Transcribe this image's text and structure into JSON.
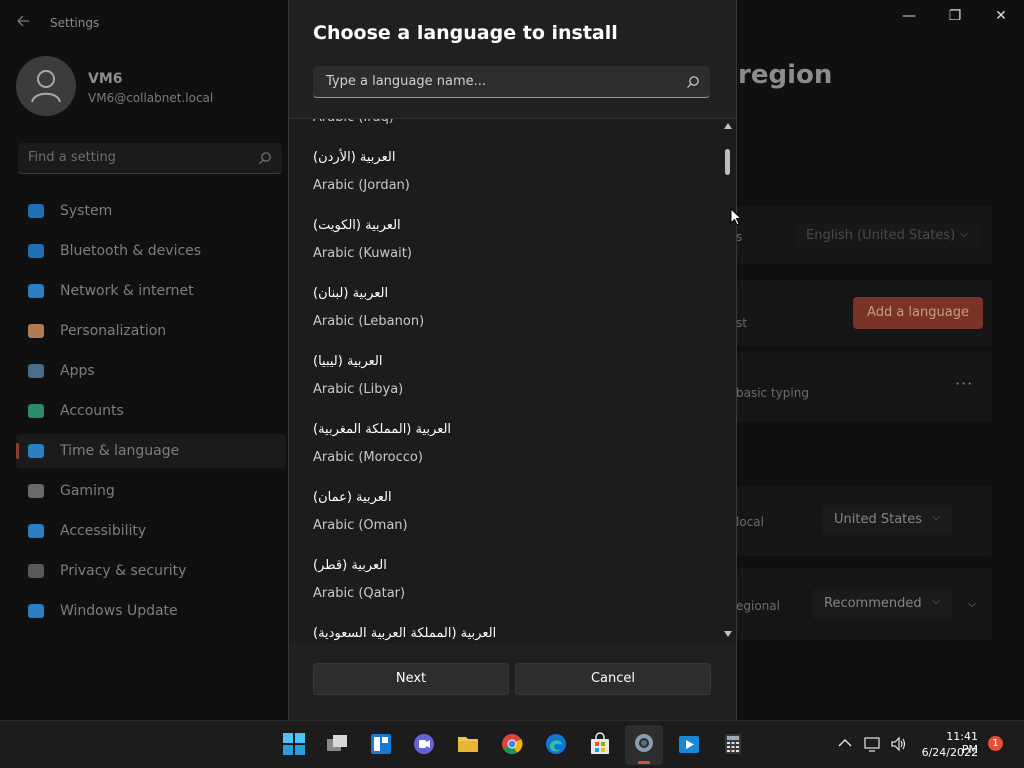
{
  "window": {
    "app_title": "Settings",
    "controls": {
      "minimize": "—",
      "maximize": "❐",
      "close": "✕"
    }
  },
  "profile": {
    "name": "VM6",
    "email": "VM6@collabnet.local"
  },
  "settings_search": {
    "placeholder": "Find a setting"
  },
  "nav": {
    "items": [
      {
        "label": "System",
        "icon": "system-icon",
        "color": "#1f6fb5"
      },
      {
        "label": "Bluetooth & devices",
        "icon": "bluetooth-icon",
        "color": "#1f6fb5"
      },
      {
        "label": "Network & internet",
        "icon": "network-icon",
        "color": "#2a7fc4"
      },
      {
        "label": "Personalization",
        "icon": "brush-icon",
        "color": "#b07a52"
      },
      {
        "label": "Apps",
        "icon": "apps-icon",
        "color": "#4a6e8a"
      },
      {
        "label": "Accounts",
        "icon": "accounts-icon",
        "color": "#2e8b6a"
      },
      {
        "label": "Time & language",
        "icon": "globe-clock-icon",
        "color": "#2a7fc4"
      },
      {
        "label": "Gaming",
        "icon": "gaming-icon",
        "color": "#6a6a6a"
      },
      {
        "label": "Accessibility",
        "icon": "accessibility-icon",
        "color": "#2a7fc4"
      },
      {
        "label": "Privacy & security",
        "icon": "shield-icon",
        "color": "#5a5a5a"
      },
      {
        "label": "Windows Update",
        "icon": "update-icon",
        "color": "#2a7fc4"
      }
    ],
    "active_index": 6
  },
  "background_page": {
    "heading_fragment": "region",
    "windows_display_language": "English (United States)",
    "add_language_label": "Add a language",
    "frag_s": "s",
    "frag_st": "st",
    "frag_basic_typing": "basic typing",
    "frag_local": "local",
    "frag_regional": "egional",
    "country_value": "United States",
    "format_value": "Recommended",
    "more_label": "···",
    "accent_color": "#7a3326"
  },
  "dialog": {
    "title": "Choose a language to install",
    "search_placeholder": "Type a language name...",
    "languages": [
      {
        "native": "",
        "english": "Arabic (Iraq)"
      },
      {
        "native": "العربية (الأردن)",
        "english": "Arabic (Jordan)"
      },
      {
        "native": "العربية (الكويت)",
        "english": "Arabic (Kuwait)"
      },
      {
        "native": "العربية (لبنان)",
        "english": "Arabic (Lebanon)"
      },
      {
        "native": "العربية (ليبيا)",
        "english": "Arabic (Libya)"
      },
      {
        "native": "العربية (المملكة المغربية)",
        "english": "Arabic (Morocco)"
      },
      {
        "native": "العربية (عمان)",
        "english": "Arabic (Oman)"
      },
      {
        "native": "العربية (قطر)",
        "english": "Arabic (Qatar)"
      },
      {
        "native": "العربية (المملكة العربية السعودية)",
        "english": ""
      }
    ],
    "next_label": "Next",
    "cancel_label": "Cancel"
  },
  "taskbar": {
    "apps": [
      "start-icon",
      "task-view-icon",
      "widgets-icon",
      "chat-icon",
      "file-explorer-icon",
      "chrome-icon",
      "edge-icon",
      "store-icon",
      "settings-icon",
      "photos-icon",
      "calculator-icon"
    ],
    "active_app": "settings-icon",
    "time": "11:41 PM",
    "date": "6/24/2022",
    "notification_count": "1"
  }
}
